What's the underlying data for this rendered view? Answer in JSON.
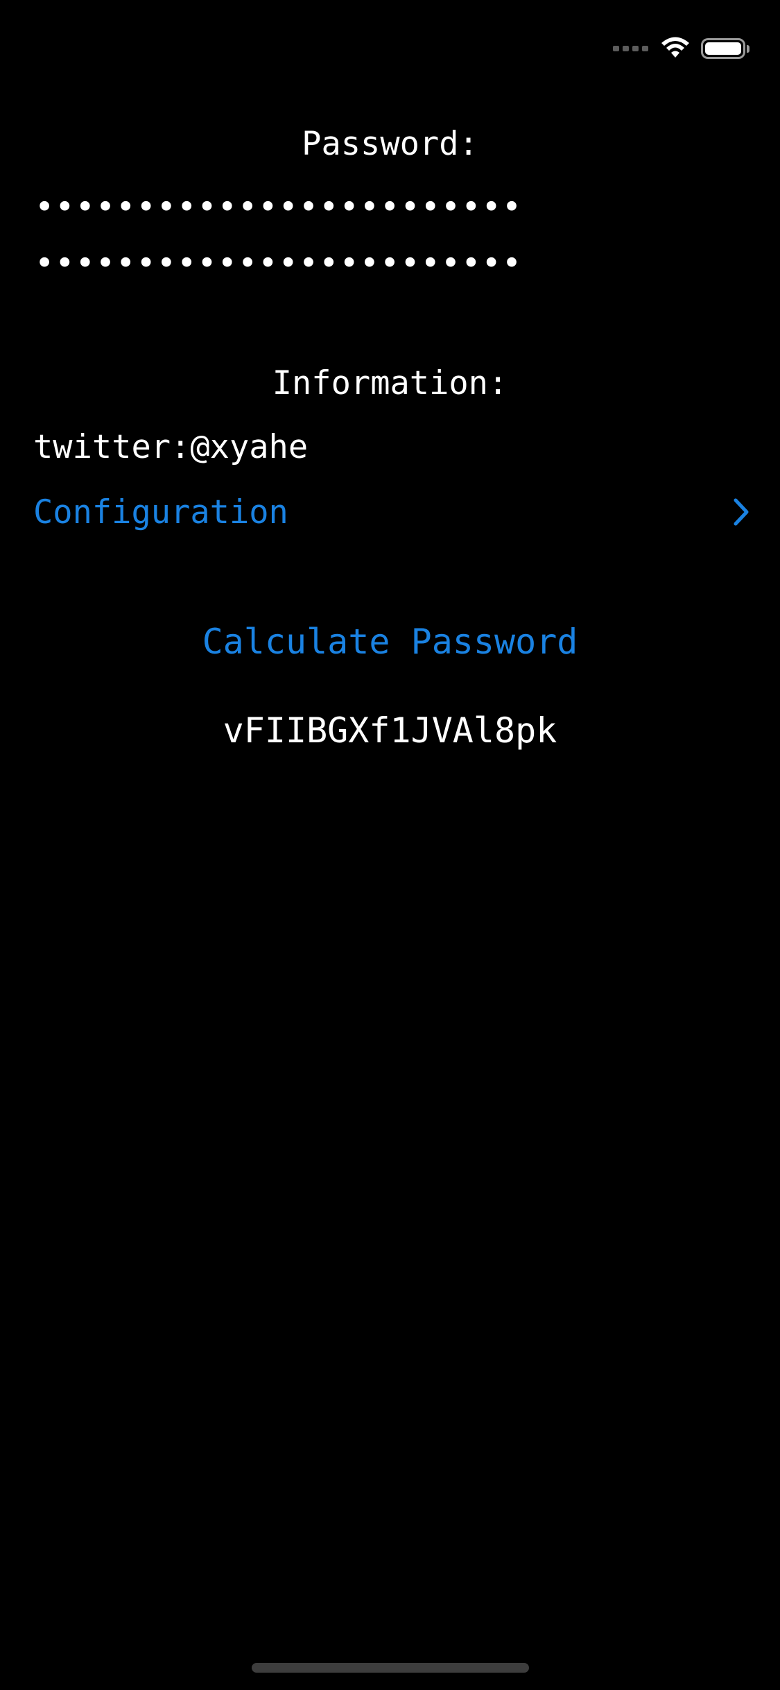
{
  "status_bar": {
    "signal_icon": "cellular-signal-icon",
    "wifi_icon": "wifi-icon",
    "battery_icon": "battery-icon",
    "battery_level": 1.0
  },
  "password": {
    "label": "Password:",
    "field_1_value": "••••••••••••••••••••••••",
    "field_2_value": "••••••••••••••••••••••••"
  },
  "information": {
    "label": "Information:",
    "value": "twitter:@xyahe"
  },
  "configuration": {
    "label": "Configuration",
    "chevron_icon": "chevron-right-icon"
  },
  "actions": {
    "calculate_label": "Calculate Password"
  },
  "result": {
    "value": "vFIIBGXf1JVAl8pk"
  },
  "colors": {
    "background": "#000000",
    "accent": "#1a82e2",
    "text": "#ffffff"
  }
}
